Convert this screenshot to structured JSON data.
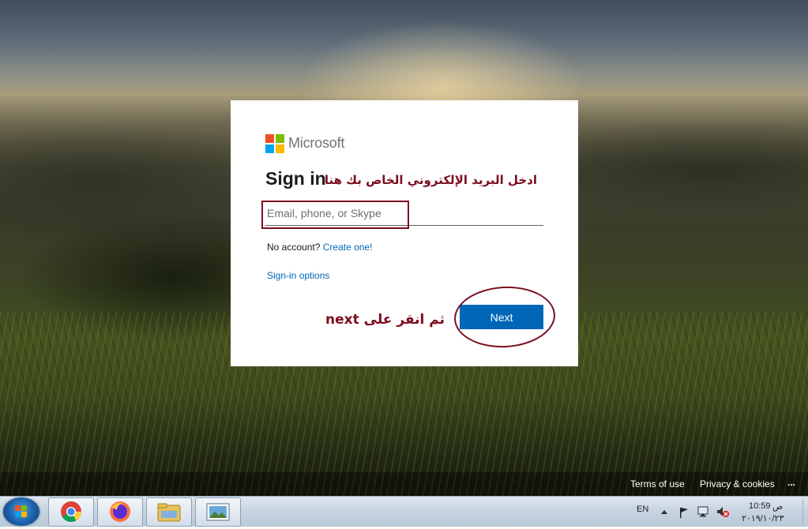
{
  "dialog": {
    "brand": "Microsoft",
    "title": "Sign in",
    "email_placeholder": "Email, phone, or Skype",
    "no_account_text": "No account?",
    "create_link": "Create one!",
    "signin_options": "Sign-in options",
    "next_button": "Next"
  },
  "annotations": {
    "email_note": "ادخل البريد الإلكتروني الخاص بك هنا",
    "next_note": "ثم انقر على next"
  },
  "footer": {
    "terms": "Terms of use",
    "privacy": "Privacy & cookies",
    "more": "..."
  },
  "taskbar": {
    "language": "EN",
    "time": "10:59",
    "period": "ص",
    "date": "٢٠١٩/١٠/٢٣",
    "apps": [
      "chrome",
      "firefox",
      "file-explorer",
      "photo-viewer"
    ]
  },
  "colors": {
    "microsoft_red": "#f25022",
    "microsoft_green": "#7fba00",
    "microsoft_blue": "#00a4ef",
    "microsoft_yellow": "#ffb900",
    "accent": "#0067b8",
    "annotation": "#7b0d1e"
  }
}
